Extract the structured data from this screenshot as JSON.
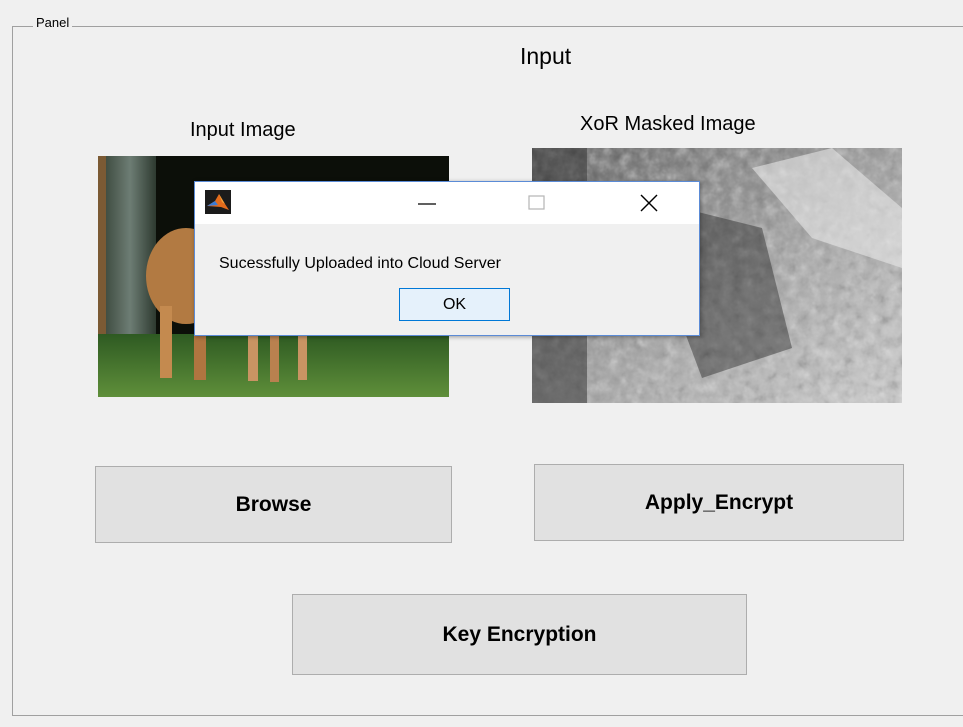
{
  "panel": {
    "legend": "Panel",
    "title": "Input"
  },
  "images": {
    "input_title": "Input Image",
    "masked_title": "XoR Masked Image"
  },
  "buttons": {
    "browse": "Browse",
    "apply_encrypt": "Apply_Encrypt",
    "key_encryption": "Key Encryption"
  },
  "dialog": {
    "app_icon": "matlab-icon",
    "message": "Sucessfully Uploaded into Cloud Server",
    "ok_label": "OK"
  },
  "colors": {
    "background": "#f0f0f0",
    "button_face": "#e1e1e1",
    "ok_border": "#0078d7",
    "dialog_border": "#5b8bd6"
  }
}
